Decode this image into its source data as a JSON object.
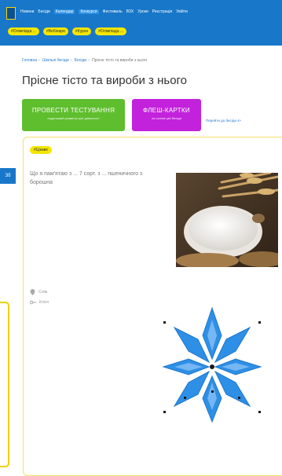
{
  "nav": {
    "links": [
      "Новини",
      "Бесіди",
      "Календар",
      "Конкурси",
      "Фестиваль",
      "ВЗХ",
      "Уроки",
      "Реєстрація",
      "Увійти"
    ]
  },
  "chips": [
    "#Олімпіада ...",
    "#Вебінари",
    "#Курси",
    "#Олімпіада ..."
  ],
  "breadcrumb": [
    "Головна",
    "Шкільні бесіди",
    "Бесіди",
    "Прісне тісто та вироби з нього"
  ],
  "title": "Прісне тісто та вироби з нього",
  "actions": {
    "test": {
      "label": "ПРОВЕСТИ ТЕСТУВАННЯ",
      "sub": "подальший розвиток цієї діяльності"
    },
    "flash": {
      "label": "ФЛЕШ-КАРТКИ",
      "sub": "на основі цієї бесіди"
    },
    "side_link": "Перейти до бесіди 4+"
  },
  "card": {
    "badge": "#Цікаве",
    "quote": "Що я пам'ятаю з ... 7 сорт. з ... пшеничного з борошна",
    "meta_1": "Слім",
    "meta_2": "Ключ"
  },
  "left_tab": "Зб",
  "colors": {
    "nav_bg": "#1877c9",
    "chip_bg": "#f4e600",
    "green_button": "#5fbe2e",
    "purple_button": "#c222dc",
    "ornament_blue": "#2e8fe6"
  },
  "icons": [
    "location-pin-icon",
    "key-icon"
  ]
}
